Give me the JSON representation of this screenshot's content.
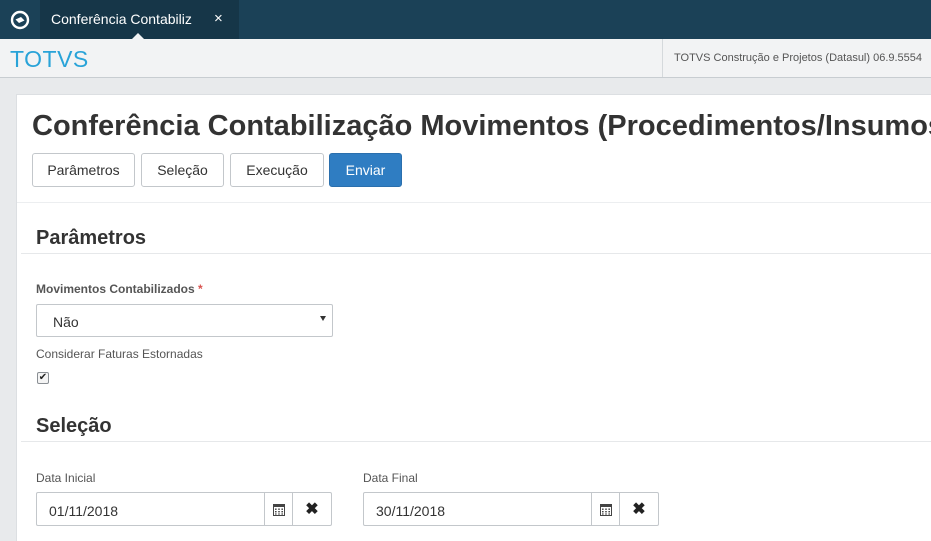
{
  "topbar": {
    "logo_icon": "totvs-logo-icon",
    "tab": {
      "label": "Conferência Contabiliz",
      "close": "×"
    }
  },
  "header": {
    "brand": "TOTVS",
    "company": "TOTVS Construção e Projetos (Datasul) 06.9.5554"
  },
  "page": {
    "title": "Conferência Contabilização Movimentos (Procedimentos/Insumos)",
    "buttons": {
      "parametros": "Parâmetros",
      "selecao": "Seleção",
      "execucao": "Execução",
      "enviar": "Enviar"
    }
  },
  "parametros": {
    "title": "Parâmetros",
    "movimentos_label": "Movimentos Contabilizados",
    "required_mark": "*",
    "movimentos_value": "Não",
    "faturas_label": "Considerar Faturas Estornadas",
    "faturas_checked": true,
    "check_glyph": "✔"
  },
  "selecao": {
    "title": "Seleção",
    "data_inicial_label": "Data Inicial",
    "data_inicial_value": "01/11/2018",
    "data_final_label": "Data Final",
    "data_final_value": "30/11/2018",
    "clear_glyph": "✖"
  },
  "colors": {
    "topbar": "#1b4157",
    "brand": "#29a3d8",
    "primary_button": "#2f7dc2",
    "required": "#d9534f"
  }
}
